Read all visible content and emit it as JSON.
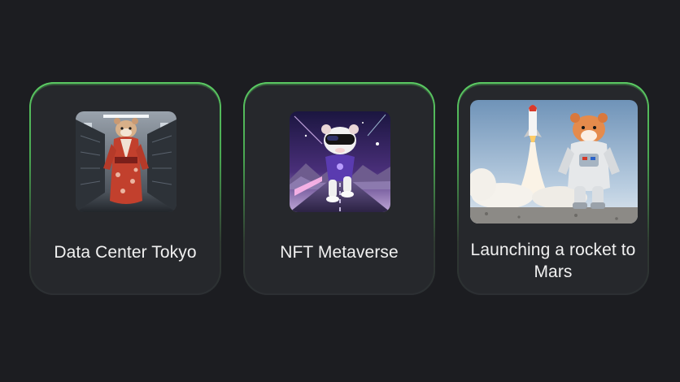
{
  "cards": [
    {
      "title": "Data Center Tokyo",
      "image": "hamster-in-kimono-server-room"
    },
    {
      "title": "NFT Metaverse",
      "image": "hamster-vr-goggles-running-neon-road"
    },
    {
      "title": "Launching a rocket to Mars",
      "image": "hamster-astronaut-rocket-launch"
    }
  ],
  "colors": {
    "background": "#1c1d21",
    "card": "#26282c",
    "accent_border": "#52b95a",
    "text": "#f1f1f1"
  }
}
